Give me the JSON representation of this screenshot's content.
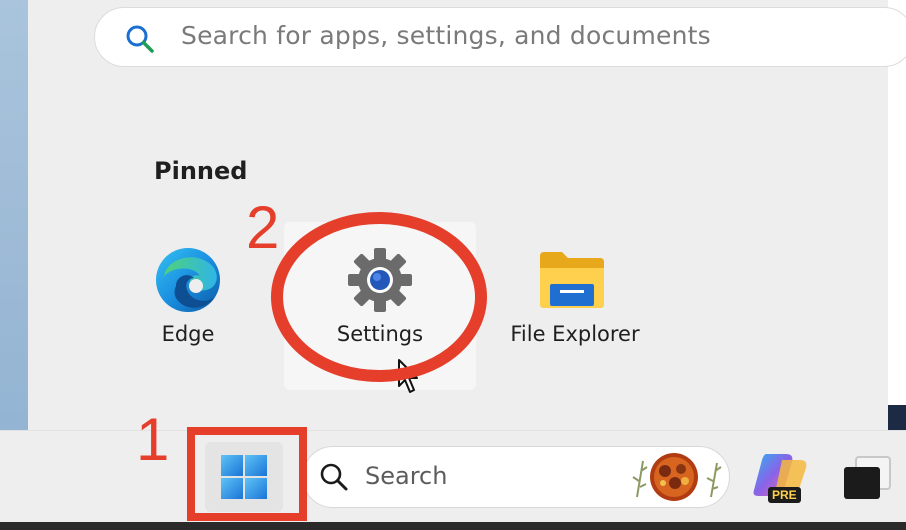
{
  "start_menu": {
    "search": {
      "placeholder": "Search for apps, settings, and documents"
    },
    "pinned": {
      "title": "Pinned",
      "apps": [
        {
          "label": "Edge",
          "icon": "edge-icon"
        },
        {
          "label": "Settings",
          "icon": "gear-icon"
        },
        {
          "label": "File Explorer",
          "icon": "folder-icon"
        }
      ]
    }
  },
  "annotations": {
    "step1": "1",
    "step2": "2",
    "color": "#e53e2b"
  },
  "taskbar": {
    "search_label": "Search",
    "pinned_icons": [
      "windows-start-icon",
      "search-icon",
      "search-highlight-food-icon",
      "copilot-pre-icon",
      "task-view-icon"
    ],
    "copilot_badge": "PRE"
  },
  "colors": {
    "panel": "#eeeeee",
    "accent_blue": "#0078d4",
    "annotation_red": "#e53e2b"
  }
}
